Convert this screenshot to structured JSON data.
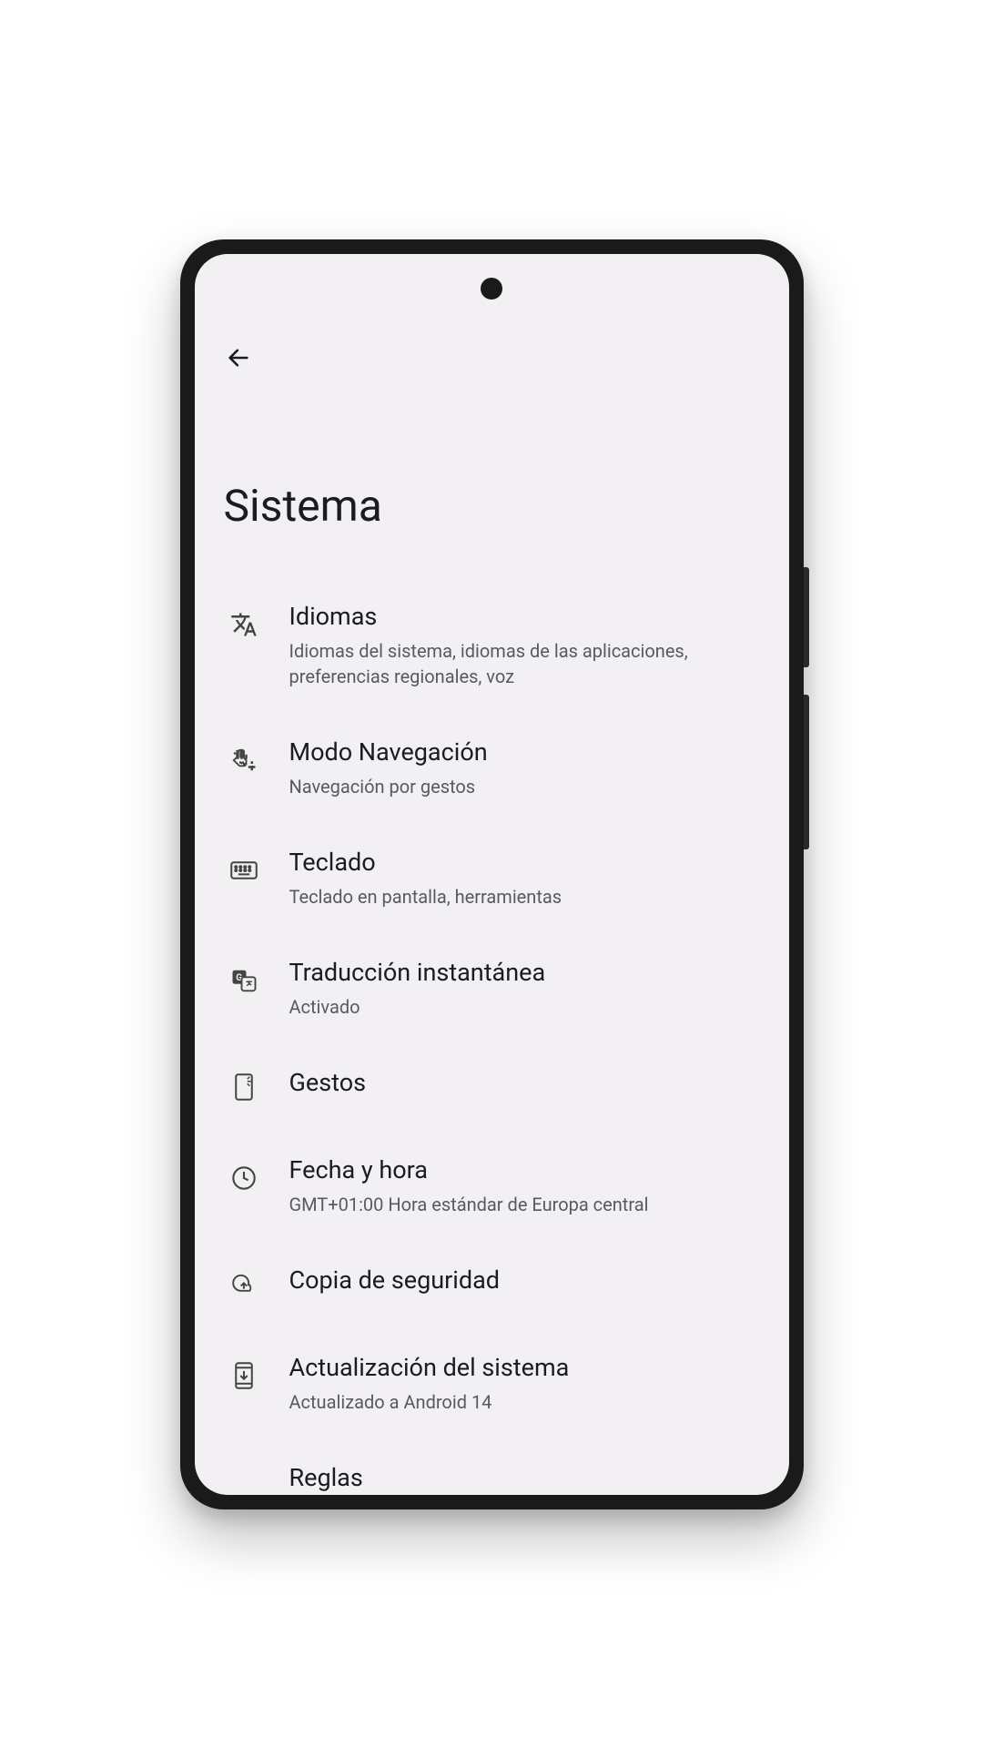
{
  "header": {
    "title": "Sistema"
  },
  "settings": [
    {
      "icon": "translate",
      "title": "Idiomas",
      "subtitle": "Idiomas del sistema, idiomas de las aplicaciones, preferencias regionales, voz"
    },
    {
      "icon": "navigation",
      "title": "Modo Navegación",
      "subtitle": "Navegación por gestos"
    },
    {
      "icon": "keyboard",
      "title": "Teclado",
      "subtitle": "Teclado en pantalla, herramientas"
    },
    {
      "icon": "translate-instant",
      "title": "Traducción instantánea",
      "subtitle": "Activado"
    },
    {
      "icon": "gestures",
      "title": "Gestos",
      "subtitle": ""
    },
    {
      "icon": "clock",
      "title": "Fecha y hora",
      "subtitle": "GMT+01:00 Hora estándar de Europa central"
    },
    {
      "icon": "cloud-backup",
      "title": "Copia de seguridad",
      "subtitle": ""
    },
    {
      "icon": "system-update",
      "title": "Actualización del sistema",
      "subtitle": "Actualizado a Android 14"
    },
    {
      "icon": "rules",
      "title": "Reglas",
      "subtitle": ""
    }
  ]
}
